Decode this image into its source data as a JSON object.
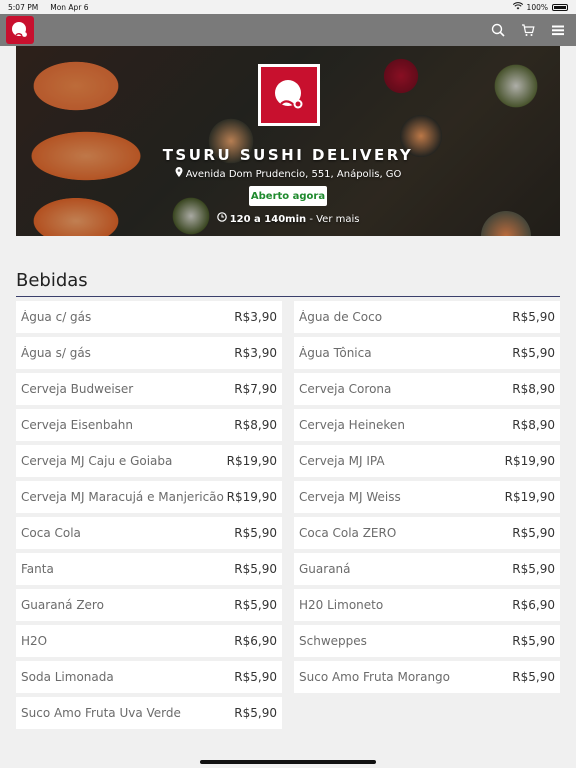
{
  "status_bar": {
    "time": "5:07 PM",
    "date": "Mon Apr 6",
    "battery": "100%"
  },
  "navbar": {
    "icons": [
      "logo-icon",
      "search-icon",
      "cart-icon",
      "menu-icon"
    ],
    "background": "#7a7a7a",
    "brand_color": "#c8102e"
  },
  "hero": {
    "title": "TSURU SUSHI DELIVERY",
    "address": "Avenida Dom Prudencio, 551, Anápolis, GO",
    "status": "Aberto agora",
    "delivery_time": "120 a 140min",
    "more_link": "- Ver mais",
    "status_color": "#1f8a2e"
  },
  "section": {
    "title": "Bebidas"
  },
  "items": [
    {
      "name": "Água c/ gás",
      "price": "R$3,90"
    },
    {
      "name": "Água de Coco",
      "price": "R$5,90"
    },
    {
      "name": "Água s/ gás",
      "price": "R$3,90"
    },
    {
      "name": "Água Tônica",
      "price": "R$5,90"
    },
    {
      "name": "Cerveja Budweiser",
      "price": "R$7,90"
    },
    {
      "name": "Cerveja Corona",
      "price": "R$8,90"
    },
    {
      "name": "Cerveja Eisenbahn",
      "price": "R$8,90"
    },
    {
      "name": "Cerveja Heineken",
      "price": "R$8,90"
    },
    {
      "name": "Cerveja MJ Caju e Goiaba",
      "price": "R$19,90"
    },
    {
      "name": "Cerveja MJ IPA",
      "price": "R$19,90"
    },
    {
      "name": "Cerveja MJ Maracujá e Manjericão",
      "price": "R$19,90"
    },
    {
      "name": "Cerveja MJ Weiss",
      "price": "R$19,90"
    },
    {
      "name": "Coca Cola",
      "price": "R$5,90"
    },
    {
      "name": "Coca Cola ZERO",
      "price": "R$5,90"
    },
    {
      "name": "Fanta",
      "price": "R$5,90"
    },
    {
      "name": "Guaraná",
      "price": "R$5,90"
    },
    {
      "name": "Guaraná Zero",
      "price": "R$5,90"
    },
    {
      "name": "H20 Limoneto",
      "price": "R$6,90"
    },
    {
      "name": "H2O",
      "price": "R$6,90"
    },
    {
      "name": "Schweppes",
      "price": "R$5,90"
    },
    {
      "name": "Soda Limonada",
      "price": "R$5,90"
    },
    {
      "name": "Suco Amo Fruta Morango",
      "price": "R$5,90"
    },
    {
      "name": "Suco Amo Fruta Uva Verde",
      "price": "R$5,90"
    }
  ]
}
